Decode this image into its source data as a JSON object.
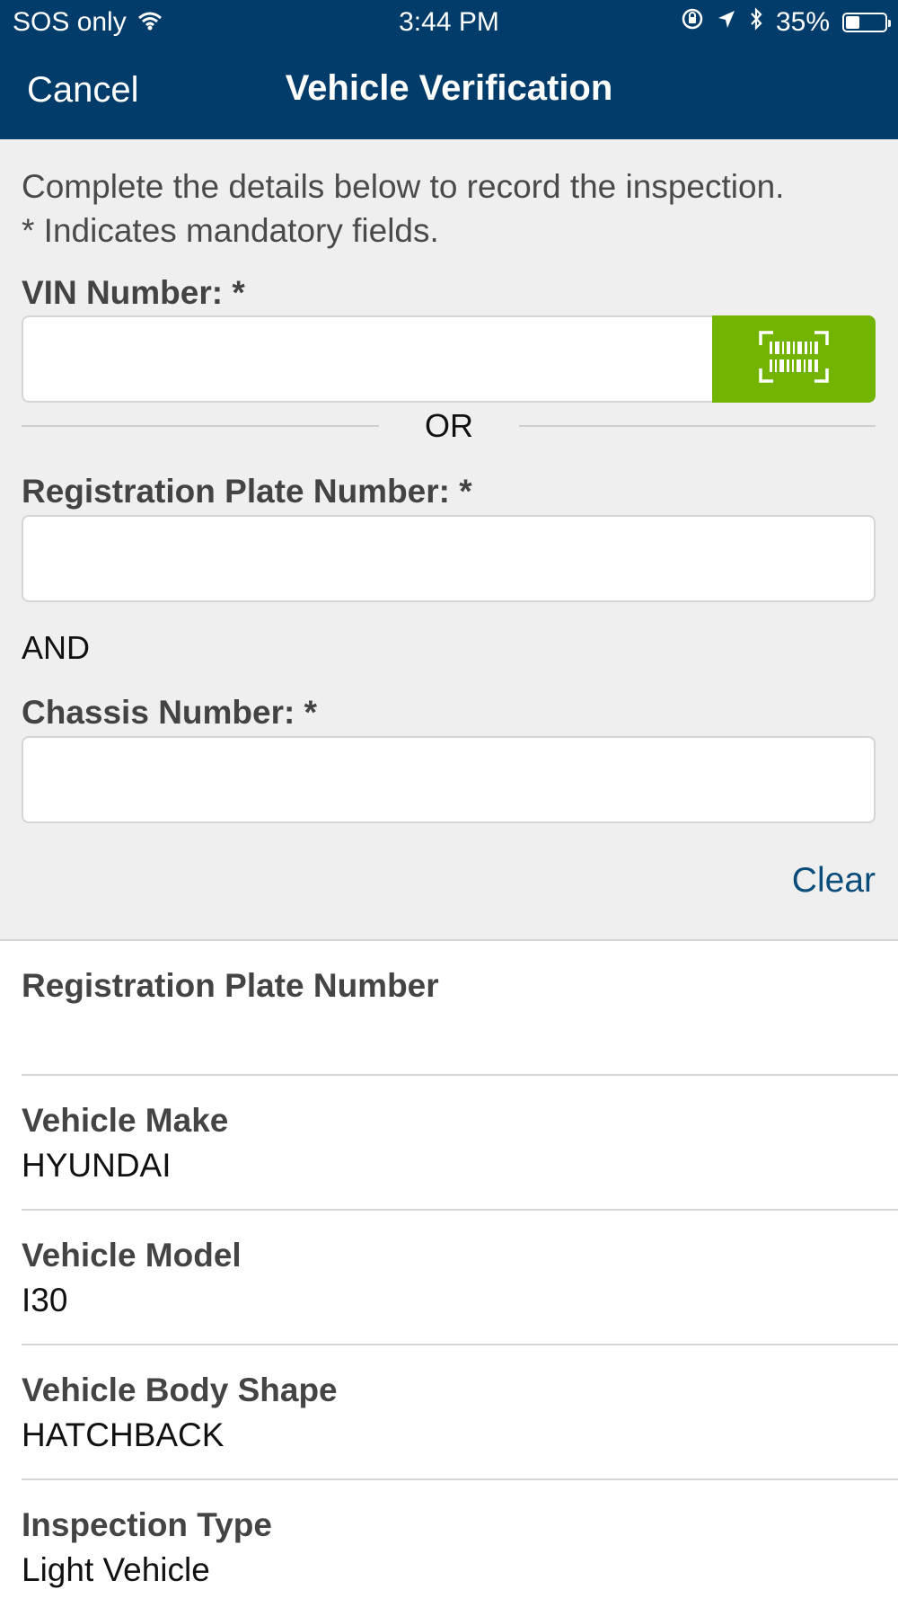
{
  "status_bar": {
    "carrier": "SOS only",
    "time": "3:44 PM",
    "battery_percent": "35%",
    "battery_level": 0.35,
    "icons": [
      "wifi-icon",
      "orientation-lock-icon",
      "location-icon",
      "bluetooth-icon",
      "battery-icon"
    ]
  },
  "nav": {
    "cancel_label": "Cancel",
    "title": "Vehicle Verification"
  },
  "form": {
    "intro_line1": "Complete the details below to record the inspection.",
    "intro_line2": "* Indicates mandatory fields.",
    "vin_label": "VIN Number: *",
    "vin_value": "",
    "scan_icon": "barcode-scan-icon",
    "or_text": "OR",
    "registration_label": "Registration Plate Number: *",
    "registration_value": "",
    "and_text": "AND",
    "chassis_label": "Chassis Number: *",
    "chassis_value": "",
    "clear_label": "Clear"
  },
  "details": [
    {
      "label": "Registration Plate Number",
      "value": ""
    },
    {
      "label": "Vehicle Make",
      "value": "HYUNDAI"
    },
    {
      "label": "Vehicle Model",
      "value": "I30"
    },
    {
      "label": "Vehicle Body Shape",
      "value": "HATCHBACK"
    },
    {
      "label": "Inspection Type",
      "value": "Light Vehicle"
    }
  ],
  "colors": {
    "header": "#023c6a",
    "scan_button": "#73b400",
    "link": "#0a4c7a",
    "panel_background": "#efefef"
  }
}
